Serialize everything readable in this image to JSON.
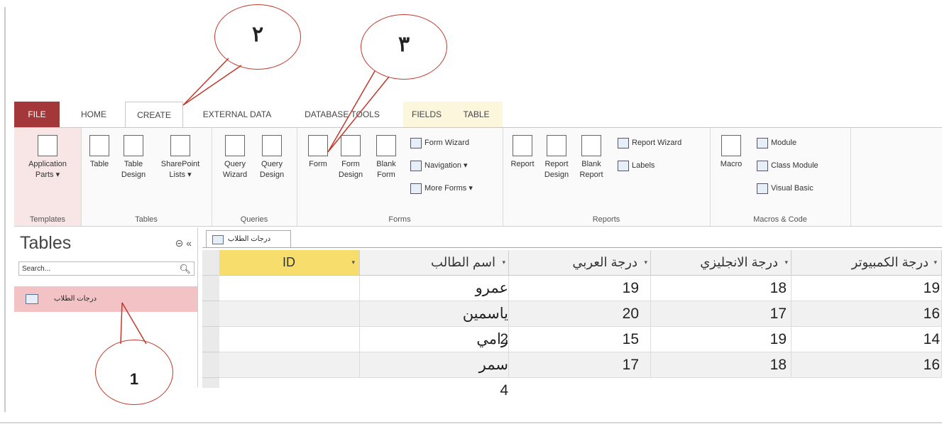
{
  "ribbon_tabs": [
    "FILE",
    "HOME",
    "CREATE",
    "EXTERNAL DATA",
    "DATABASE TOOLS",
    "FIELDS",
    "TABLE"
  ],
  "groups": {
    "templates": {
      "label": "Templates",
      "application_parts": "Application Parts ▾"
    },
    "tables": {
      "label": "Tables",
      "table": "Table",
      "table_design": "Table Design",
      "sharepoint_lists": "SharePoint Lists ▾"
    },
    "queries": {
      "label": "Queries",
      "query_wizard": "Query Wizard",
      "query_design": "Query Design"
    },
    "forms": {
      "label": "Forms",
      "form": "Form",
      "form_design": "Form Design",
      "blank_form": "Blank Form",
      "form_wizard": "Form Wizard",
      "navigation": "Navigation ▾",
      "more_forms": "More Forms ▾"
    },
    "reports": {
      "label": "Reports",
      "report": "Report",
      "report_design": "Report Design",
      "blank_report": "Blank Report",
      "report_wizard": "Report Wizard",
      "labels": "Labels"
    },
    "macros": {
      "label": "Macros & Code",
      "macro": "Macro",
      "module": "Module",
      "class_module": "Class Module",
      "visual_basic": "Visual Basic"
    }
  },
  "nav_pane": {
    "title": "Tables",
    "controls": "⊝ «",
    "search_placeholder": "Search...",
    "item": "درجات الطلاب"
  },
  "document_tab": "درجات الطلاب",
  "datasheet": {
    "columns": [
      "ID",
      "اسم الطالب",
      "درجة العربي",
      "درجة الانجليزي",
      "درجة الكمبيوتر"
    ],
    "rows": [
      {
        "name": "عمرو 1",
        "arabic": "19",
        "english": "18",
        "computer": "19"
      },
      {
        "name": "ياسمين 2",
        "arabic": "20",
        "english": "17",
        "computer": "16"
      },
      {
        "name": "رامي 3",
        "arabic": "15",
        "english": "19",
        "computer": "14"
      },
      {
        "name": "سمر 4",
        "arabic": "17",
        "english": "18",
        "computer": "16"
      }
    ]
  },
  "callouts": {
    "create_tab": "٢",
    "form_button": "٣",
    "table_item": "1"
  },
  "colors": {
    "file_tab": "#a4373a",
    "selected_item": "#f3c2c4",
    "id_header": "#f7dd6c",
    "callout_stroke": "#c0392b"
  }
}
